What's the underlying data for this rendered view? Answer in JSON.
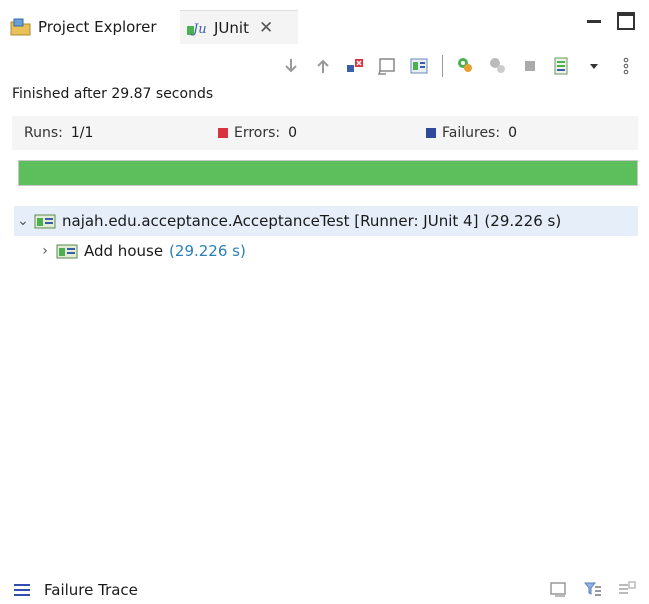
{
  "tabs": [
    {
      "label": "Project Explorer",
      "icon": "project-explorer-icon"
    },
    {
      "label": "JUnit",
      "icon": "junit-icon",
      "active": true
    }
  ],
  "toolbar": {
    "icons": [
      "next-failure-icon",
      "previous-failure-icon",
      "show-failures-only-icon",
      "scroll-lock-icon",
      "show-skipped-icon",
      "rerun-test-icon",
      "rerun-failed-first-icon",
      "stop-icon",
      "test-history-icon",
      "view-menu-icon",
      "more-icon"
    ]
  },
  "status": {
    "text": "Finished after 29.87 seconds"
  },
  "counters": {
    "runs_label": "Runs:",
    "runs_value": "1/1",
    "errors_label": "Errors:",
    "errors_value": "0",
    "failures_label": "Failures:",
    "failures_value": "0"
  },
  "progress": {
    "fraction": 1.0,
    "color": "#5cbf5c"
  },
  "tree": {
    "root": {
      "label": "najah.edu.acceptance.AcceptanceTest [Runner: JUnit 4]",
      "time": "(29.226 s)"
    },
    "child": {
      "label": "Add house",
      "time": "(29.226 s)"
    }
  },
  "footer": {
    "label": "Failure Trace"
  },
  "colors": {
    "accent_blue": "#2b7fb8",
    "pass_green": "#5cbf5c",
    "error_red": "#d9333f",
    "failure_blue": "#2f4a9a"
  }
}
